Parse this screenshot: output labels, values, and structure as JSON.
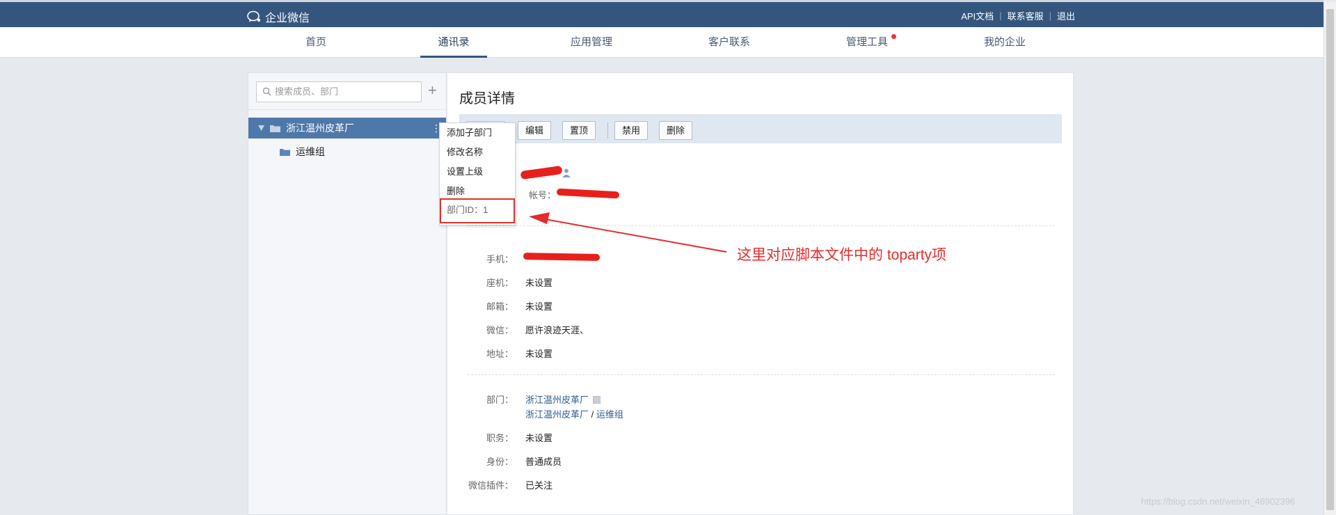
{
  "topbar": {
    "logo": "企业微信",
    "links": [
      "API文档",
      "联系客服",
      "退出"
    ],
    "separator": "|"
  },
  "nav": {
    "items": [
      "首页",
      "通讯录",
      "应用管理",
      "客户联系",
      "管理工具",
      "我的企业"
    ],
    "active": "通讯录"
  },
  "sidebar": {
    "search_placeholder": "搜索成员、部门",
    "add": "+",
    "root_dept": "浙江温州皮革厂",
    "more": "⋮",
    "child_dept": "运维组"
  },
  "context_menu": {
    "items": [
      "添加子部门",
      "修改名称",
      "设置上级",
      "删除"
    ],
    "dept_id": "部门ID：1"
  },
  "main": {
    "title": "成员详情",
    "toolbar": {
      "hidden_btn": "",
      "edit": "编辑",
      "pin": "置顶",
      "disable": "禁用",
      "delete": "删除"
    },
    "account_label": "帐号：",
    "contact": {
      "phone_label": "手机：",
      "landline_label": "座机：",
      "landline": "未设置",
      "email_label": "邮箱：",
      "email": "未设置",
      "wechat_label": "微信：",
      "wechat": "愿许浪迹天涯、",
      "address_label": "地址：",
      "address": "未设置"
    },
    "org": {
      "dept_label": "部门：",
      "dept_primary": "浙江温州皮革厂",
      "dept_path_root": "浙江温州皮革厂",
      "dept_path_sep": " / ",
      "dept_path_child": "运维组",
      "position_label": "职务：",
      "position": "未设置",
      "role_label": "身份：",
      "role": "普通成员",
      "plugin_label": "微信插件：",
      "plugin": "已关注"
    }
  },
  "annotation": "这里对应脚本文件中的 toparty项",
  "watermark": "https://blog.csdn.net/weixin_46902396",
  "colors": {
    "header": "#34567e",
    "tree_selected": "#4e78a9",
    "annotation": "#e62b2b",
    "link": "#2f5c93"
  }
}
